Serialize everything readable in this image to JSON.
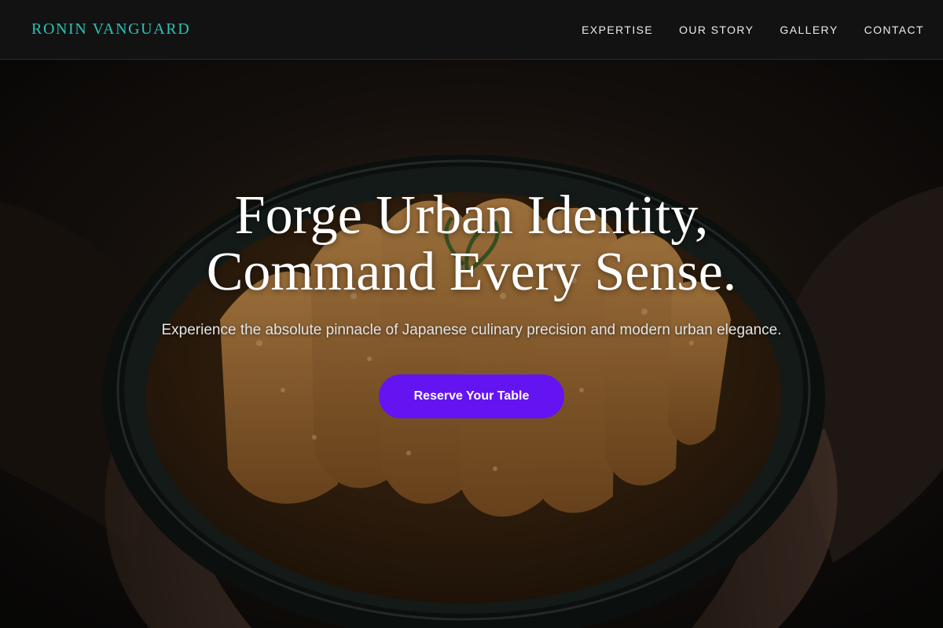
{
  "brand": {
    "name": "RONIN VANGUARD",
    "accent": "#2cc3b5"
  },
  "nav": {
    "items": [
      {
        "label": "EXPERTISE"
      },
      {
        "label": "OUR STORY"
      },
      {
        "label": "GALLERY"
      },
      {
        "label": "CONTACT"
      }
    ]
  },
  "hero": {
    "headline_line1": "Forge Urban Identity,",
    "headline_line2": "Command Every Sense.",
    "subtext": "Experience the absolute pinnacle of Japanese culinary precision and modern urban elegance.",
    "cta_label": "Reserve Your Table",
    "cta_color": "#6414f0",
    "background_image": "katsu-bowl-photo"
  }
}
